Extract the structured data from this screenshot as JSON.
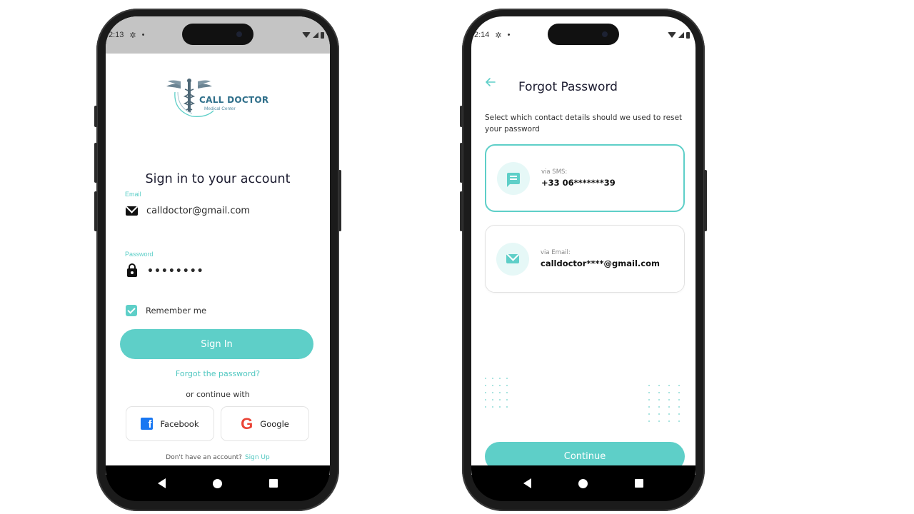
{
  "signin": {
    "status_time": "2:13",
    "logo_title": "CALL DOCTOR",
    "logo_subtitle": "Medical Center",
    "title": "Sign in to your account",
    "email_label": "Email",
    "email_value": "calldoctor@gmail.com",
    "password_label": "Password",
    "password_value": "••••••••",
    "remember_label": "Remember me",
    "remember_checked": true,
    "signin_button": "Sign In",
    "forgot_link": "Forgot the password?",
    "or_text": "or continue with",
    "facebook_label": "Facebook",
    "google_label": "Google",
    "no_account_text": "Don't have an account?",
    "signup_link": "Sign Up"
  },
  "forgot": {
    "status_time": "2:14",
    "title": "Forgot Password",
    "description": "Select which contact details should we used to reset your password",
    "options": [
      {
        "label": "via SMS:",
        "value": "+33 06*******39",
        "icon": "chat-icon",
        "selected": true
      },
      {
        "label": "via Email:",
        "value": "calldoctor****@gmail.com",
        "icon": "mail-icon",
        "selected": false
      }
    ],
    "continue_button": "Continue"
  },
  "colors": {
    "accent": "#5ecfc8",
    "accent_light": "#e6f8f7",
    "facebook": "#1877f2",
    "google": "#ea4335",
    "logo": "#2f6f8a"
  }
}
